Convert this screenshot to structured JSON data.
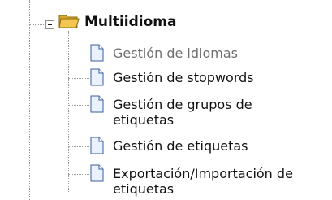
{
  "tree": {
    "root": {
      "label": "Multiidioma",
      "expanded": true,
      "expander_icon": "minus-box-icon",
      "folder_icon": "open-folder-icon"
    },
    "items": [
      {
        "label": "Gestión de idiomas",
        "icon": "document-icon",
        "state": "selected-dimmed"
      },
      {
        "label": "Gestión de stopwords",
        "icon": "document-icon"
      },
      {
        "label": "Gestión de grupos de etiquetas",
        "icon": "document-icon"
      },
      {
        "label": "Gestión de etiquetas",
        "icon": "document-icon"
      },
      {
        "label": "Exportación/Importación de etiquetas",
        "icon": "document-icon"
      }
    ],
    "colors": {
      "dimmed_text": "#6f6f6f",
      "text": "#111111",
      "folder": "#f2c64f",
      "doc_fill": "#eaf2ff",
      "doc_border": "#3a5f9c"
    }
  }
}
